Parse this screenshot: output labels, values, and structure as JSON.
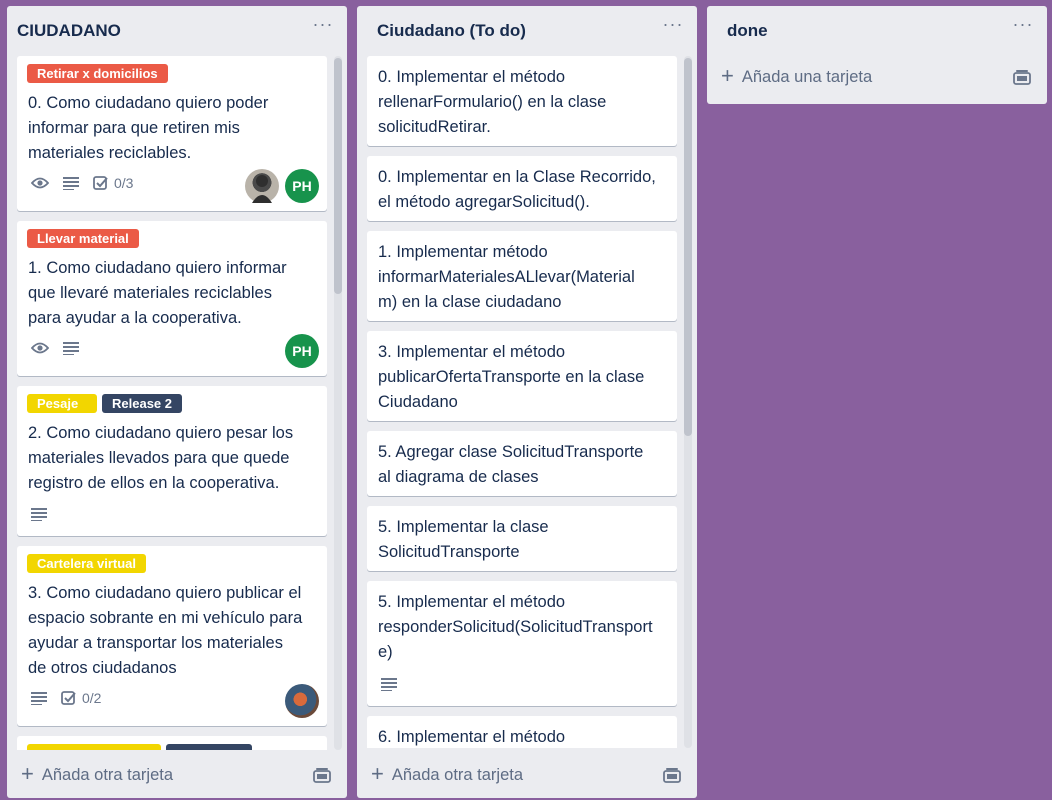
{
  "lists": [
    {
      "title": "CIUDADANO",
      "add_label": "Añada otra tarjeta",
      "cards": [
        {
          "labels": [
            {
              "text": "Retirar x domicilios",
              "color": "#eb5a46"
            }
          ],
          "text": "0. Como ciudadano quiero poder\ninformar para que retiren mis\nmateriales reciclables.",
          "checklist": "0/3",
          "avatar_initials": "PH"
        },
        {
          "labels": [
            {
              "text": "Llevar material",
              "color": "#eb5a46"
            }
          ],
          "text": "1. Como ciudadano quiero informar\nque llevaré materiales reciclables\npara ayudar a la cooperativa.",
          "avatar_initials": "PH"
        },
        {
          "labels": [
            {
              "text": "Pesaje",
              "color": "#f2d600"
            },
            {
              "text": "Release 2",
              "color": "#344563"
            }
          ],
          "text": "2. Como ciudadano quiero pesar los\nmateriales llevados para que quede\nregistro de ellos en la cooperativa."
        },
        {
          "labels": [
            {
              "text": "Cartelera virtual",
              "color": "#f2d600"
            }
          ],
          "text": "3. Como ciudadano quiero publicar el\nespacio sobrante en mi vehículo para\nayudar a transportar los materiales\nde otros ciudadanos",
          "checklist": "0/2"
        }
      ]
    },
    {
      "title": "Ciudadano (To do)",
      "add_label": "Añada otra tarjeta",
      "cards": [
        {
          "text": "0. Implementar el método\nrellenarFormulario() en la clase\nsolicitudRetirar."
        },
        {
          "text": "0. Implementar en la Clase Recorrido,\nel método agregarSolicitud()."
        },
        {
          "text": "1. Implementar método\ninformarMaterialesALlevar(Material\nm) en la clase ciudadano"
        },
        {
          "text": "3. Implementar el método\npublicarOfertaTransporte en la clase\nCiudadano"
        },
        {
          "text": "5. Agregar clase SolicitudTransporte\nal diagrama de clases"
        },
        {
          "text": "5. Implementar la clase\nSolicitudTransporte"
        },
        {
          "text": "5. Implementar el método\nresponderSolicitud(SolicitudTransport\ne)"
        },
        {
          "text": "6. Implementar el método"
        }
      ]
    },
    {
      "title": "done",
      "add_label": "Añada una tarjeta"
    }
  ],
  "colors": {
    "board_bg": "#89609e",
    "list_bg": "#ebecf0",
    "avatar_green": "#17934c"
  }
}
